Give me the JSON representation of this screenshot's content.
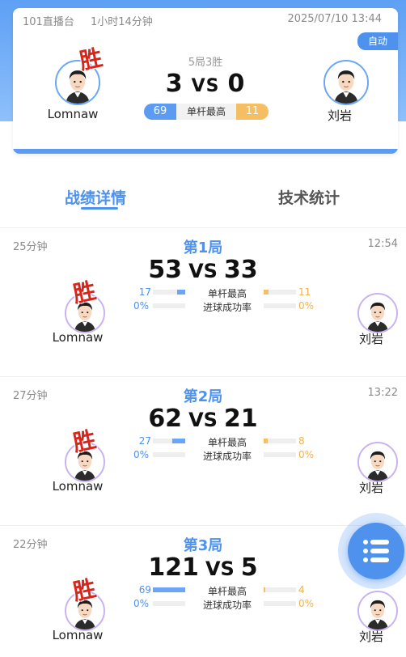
{
  "header": {
    "room": "101直播台",
    "duration": "1小时14分钟",
    "datetime": "2025/07/10 13:44",
    "auto_badge": "自动",
    "format": "5局3胜",
    "score_left": "3",
    "vs": "VS",
    "score_right": "0",
    "player_left": "Lomnaw",
    "player_right": "刘岩",
    "win_mark": "胜",
    "high_break_label": "单杆最高",
    "high_break_left": "69",
    "high_break_right": "11"
  },
  "tabs": {
    "active": "战绩详情",
    "inactive": "技术统计"
  },
  "stat_labels": {
    "high_break": "单杆最高",
    "pot_rate": "进球成功率"
  },
  "games": [
    {
      "title": "第1局",
      "duration": "25分钟",
      "time": "12:54",
      "score_left": "53",
      "score_right": "33",
      "player_left": "Lomnaw",
      "player_right": "刘岩",
      "winner_mark": "胜",
      "high_break_left": "17",
      "high_break_right": "11",
      "high_break_left_pct": 0.25,
      "high_break_right_pct": 0.16,
      "pot_left": "0%",
      "pot_right": "0%"
    },
    {
      "title": "第2局",
      "duration": "27分钟",
      "time": "13:22",
      "score_left": "62",
      "score_right": "21",
      "player_left": "Lomnaw",
      "player_right": "刘岩",
      "winner_mark": "胜",
      "high_break_left": "27",
      "high_break_right": "8",
      "high_break_left_pct": 0.39,
      "high_break_right_pct": 0.12,
      "pot_left": "0%",
      "pot_right": "0%"
    },
    {
      "title": "第3局",
      "duration": "22分钟",
      "time": "",
      "score_left": "121",
      "score_right": "5",
      "player_left": "Lomnaw",
      "player_right": "刘岩",
      "winner_mark": "胜",
      "high_break_left": "69",
      "high_break_right": "4",
      "high_break_left_pct": 1.0,
      "high_break_right_pct": 0.06,
      "pot_left": "0%",
      "pot_right": "0%"
    }
  ],
  "fab_icon": "list-icon",
  "colors": {
    "accent_blue": "#4e92ee",
    "accent_orange": "#f5be63",
    "win_red": "#d8251c"
  }
}
